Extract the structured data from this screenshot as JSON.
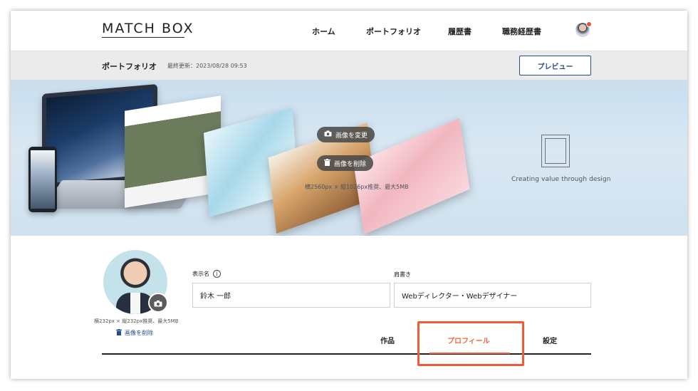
{
  "header": {
    "logo": "MATCH BOX",
    "nav": [
      "ホーム",
      "ポートフォリオ",
      "履歴書",
      "職務経歴書"
    ]
  },
  "subbar": {
    "title": "ポートフォリオ",
    "last_updated": "最終更新：2023/08/28 09:53",
    "preview_label": "プレビュー"
  },
  "hero": {
    "change_image_label": "画像を変更",
    "delete_image_label": "画像を削除",
    "size_hint": "横2560px × 縦1026px推奨、最大5MB",
    "brand_tagline": "Creating value through design"
  },
  "profile": {
    "avatar_size_hint": "横232px × 縦232px推奨、最大5MB",
    "delete_avatar_label": "画像を削除",
    "display_name_label": "表示名",
    "display_name_value": "鈴木 一郎",
    "title_label": "肩書き",
    "title_value": "Webディレクター・Webデザイナー"
  },
  "tabs": {
    "items": [
      "作品",
      "プロフィール",
      "設定"
    ],
    "active": "プロフィール"
  },
  "colors": {
    "accent": "#ee6a3e",
    "primary": "#2b4d86",
    "highlight": "#f05a36"
  }
}
